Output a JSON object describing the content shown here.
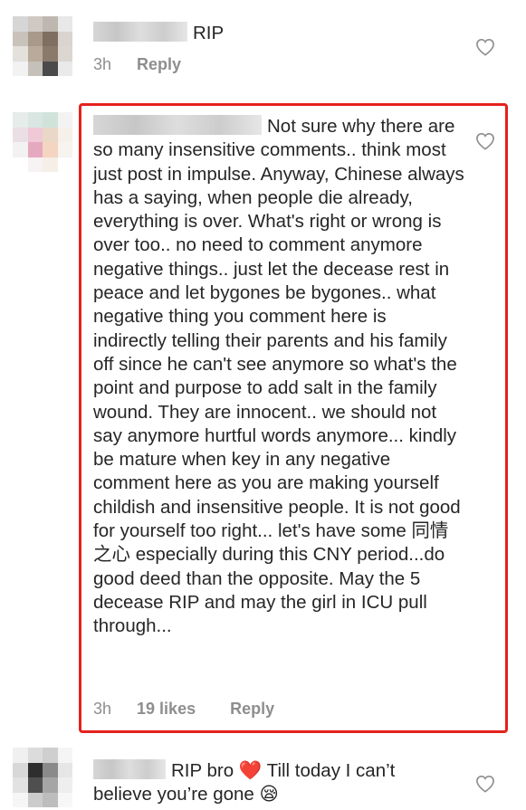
{
  "colors": {
    "highlight": "#e5211d",
    "meta_text": "#8e8e8e",
    "body_text": "#262626"
  },
  "comments": [
    {
      "text": "RIP",
      "time": "3h",
      "likes": "",
      "reply": "Reply",
      "like_icon": "heart-outline-icon"
    },
    {
      "text": "Not sure why there are so many insensitive comments.. think most just post in impulse. Anyway, Chinese always has a saying, when people die already, everything is over. What's right or wrong is over too.. no need to comment anymore negative things.. just let the decease rest in peace and let bygones be bygones.. what negative thing you comment here is indirectly telling their parents and his family off since he can't see anymore so what's the point and purpose to add salt in the family wound. They are innocent.. we should not say anymore hurtful words anymore... kindly be mature when key in any negative comment here as you are making yourself childish and insensitive people. It is not good for yourself too right... let's have some 同情之心 especially during this CNY period...do good deed than the opposite. May the 5 decease RIP and may the girl in ICU pull through...",
      "time": "3h",
      "likes": "19 likes",
      "reply": "Reply",
      "like_icon": "heart-outline-icon"
    },
    {
      "text_before_heart": "RIP bro ",
      "heart_emoji": "❤️",
      "text_after_heart": " Till today I can’t believe you’re gone ",
      "end_emoji": "😪",
      "like_icon": "heart-outline-icon"
    }
  ]
}
